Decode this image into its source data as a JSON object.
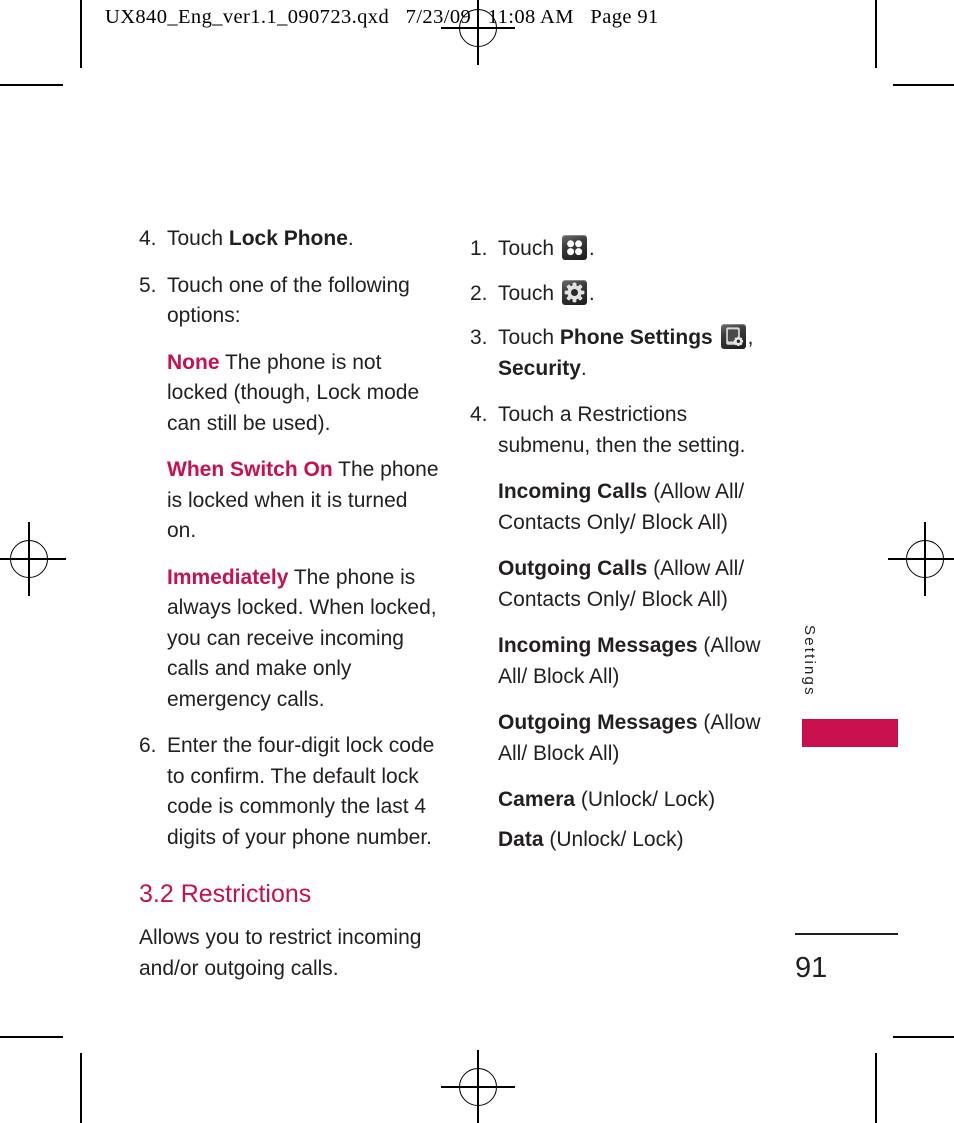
{
  "proof_header": "UX840_Eng_ver1.1_090723.qxd   7/23/09   11:08 AM   Page 91",
  "accent_color": "#c8104e",
  "left_column": {
    "steps": [
      {
        "num": "4.",
        "text_prefix": "Touch ",
        "bold": "Lock Phone",
        "text_suffix": "."
      },
      {
        "num": "5.",
        "text_prefix": "Touch one of the following options:",
        "bold": "",
        "text_suffix": ""
      }
    ],
    "options": [
      {
        "term": "None",
        "desc": " The phone is not locked (though, Lock mode can still be used)."
      },
      {
        "term": "When Switch On",
        "desc": " The phone is locked when it is turned on."
      },
      {
        "term": "Immediately",
        "desc": " The phone is always locked. When locked, you can receive incoming calls and make only emergency calls."
      }
    ],
    "step6": {
      "num": "6.",
      "text": "Enter the four-digit lock code to confirm. The default lock code is commonly the last 4 digits of your phone number."
    },
    "section_heading": "3.2 Restrictions",
    "section_body": "Allows you to restrict incoming and/or outgoing calls."
  },
  "right_column": {
    "step1": {
      "num": "1.",
      "prefix": "Touch ",
      "icon": "app-grid-icon",
      "suffix": "."
    },
    "step2": {
      "num": "2.",
      "prefix": "Touch ",
      "icon": "gear-icon",
      "suffix": "."
    },
    "step3": {
      "num": "3.",
      "prefix": "Touch ",
      "bold1": "Phone Settings",
      "icon": "phone-settings-icon",
      "mid": ", ",
      "bold2": "Security",
      "suffix": "."
    },
    "step4": {
      "num": "4.",
      "text": "Touch a Restrictions submenu, then the setting."
    },
    "restrictions": [
      {
        "name": "Incoming Calls",
        "values": " (Allow All/ Contacts Only/ Block All)"
      },
      {
        "name": "Outgoing Calls",
        "values": " (Allow All/ Contacts Only/ Block All)"
      },
      {
        "name": "Incoming Messages",
        "values": " (Allow All/ Block All)"
      },
      {
        "name": "Outgoing Messages",
        "values": " (Allow All/ Block All)"
      },
      {
        "name": "Camera",
        "values": " (Unlock/ Lock)"
      },
      {
        "name": "Data",
        "values": " (Unlock/ Lock)"
      }
    ]
  },
  "side_tab": {
    "label": "Settings"
  },
  "folio": {
    "page_number": "91"
  }
}
